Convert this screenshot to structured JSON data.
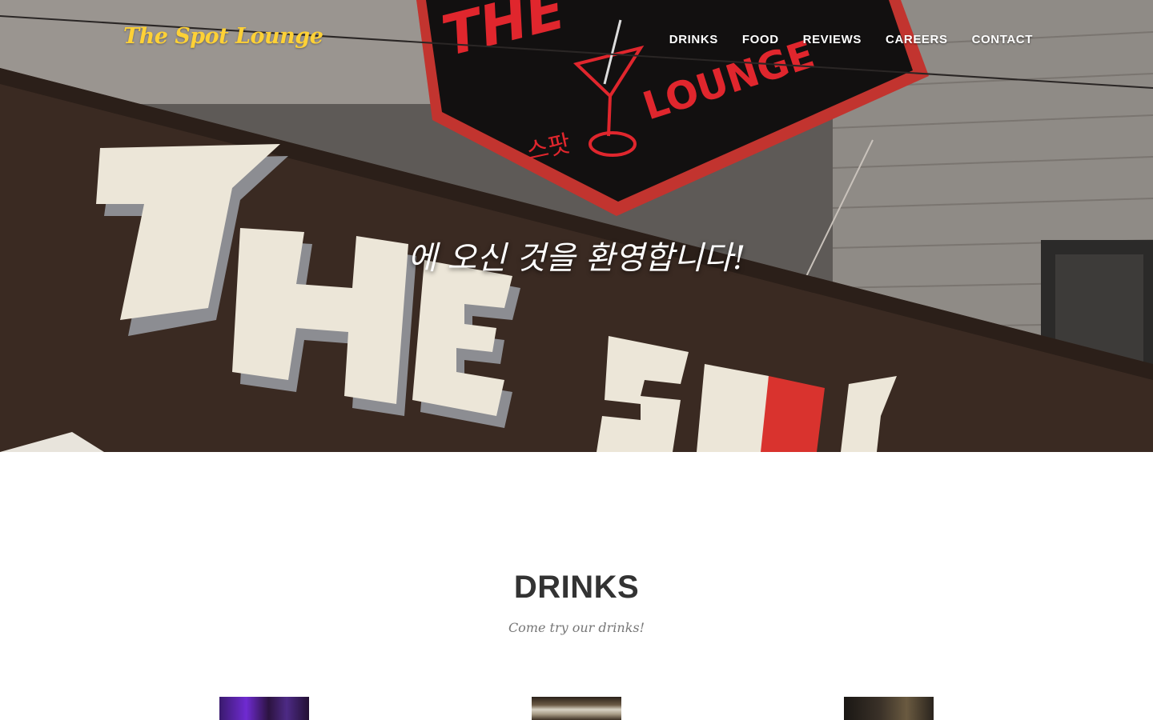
{
  "brand": {
    "name": "The Spot Lounge",
    "color": "#fed136"
  },
  "nav": {
    "items": [
      {
        "label": "DRINKS"
      },
      {
        "label": "FOOD"
      },
      {
        "label": "REVIEWS"
      },
      {
        "label": "CAREERS"
      },
      {
        "label": "CONTACT"
      }
    ]
  },
  "hero": {
    "welcome": "에 오신 것을 환영합니다!",
    "sign": {
      "awning_word_1": "THE",
      "awning_word_2": "SPOT",
      "lightbox_top": "THE",
      "lightbox_bottom": "LOUNGE",
      "lightbox_korean": "스팟"
    }
  },
  "drinks_section": {
    "title": "DRINKS",
    "subtitle": "Come try our drinks!"
  }
}
